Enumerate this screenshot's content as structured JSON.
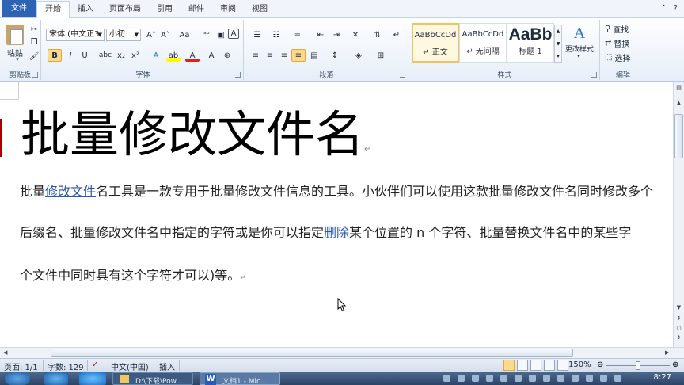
{
  "tabs": [
    "文件",
    "开始",
    "插入",
    "页面布局",
    "引用",
    "邮件",
    "审阅",
    "视图"
  ],
  "ribbon": {
    "clipboard": {
      "paste_label": "粘贴",
      "group_label": "剪贴板"
    },
    "font": {
      "font_name": "宋体 (中文正3",
      "font_size": "小初",
      "group_label": "字体",
      "bold": "B",
      "italic": "I",
      "underline": "U",
      "strike": "abc",
      "subscript": "x₂",
      "superscript": "x²",
      "grow": "A˄",
      "shrink": "A˅",
      "case": "Aa",
      "clear": "A",
      "highlight": "ab",
      "color": "A"
    },
    "paragraph": {
      "group_label": "段落"
    },
    "styles": {
      "group_label": "样式",
      "items": [
        {
          "sample": "AaBbCcDd",
          "name": "↵ 正文",
          "selected": true
        },
        {
          "sample": "AaBbCcDd",
          "name": "↵ 无间隔",
          "selected": false
        },
        {
          "sample": "AaBb",
          "name": "标题 1",
          "selected": false
        }
      ],
      "change_styles": "更改样式"
    },
    "editing": {
      "group_label": "编辑",
      "find": "查找",
      "replace": "替换",
      "select": "选择"
    }
  },
  "document": {
    "title": "批量修改文件名",
    "lines": [
      {
        "before": "批量",
        "link": "修改文件",
        "after": "名工具是一款专用于批量修改文件信息的工具。小伙伴们可以使用这款批量修改文件名同时修改多个"
      },
      {
        "before": "后缀名、批量修改文件名中指定的字符或是你可以指定",
        "link": "删除",
        "after": "某个位置的 n 个字符、批量替换文件名中的某些字"
      },
      {
        "before": "个文件中同时具有这个字符才可以)等。",
        "link": "",
        "after": ""
      }
    ],
    "pilcrow": "↵"
  },
  "status": {
    "page": "页面: 1/1",
    "words": "字数: 129",
    "language": "中文(中国)",
    "mode": "插入",
    "zoom": "150%"
  },
  "taskbar": {
    "items": [
      "D:\\下载\\Pow...",
      "文档1 - Mic..."
    ],
    "time": "8:27"
  },
  "colors": {
    "file_tab": "#2c63b5",
    "link": "#2a59a8",
    "selected_style": "#f2c35a",
    "active_toggle": "#fbd98e"
  }
}
